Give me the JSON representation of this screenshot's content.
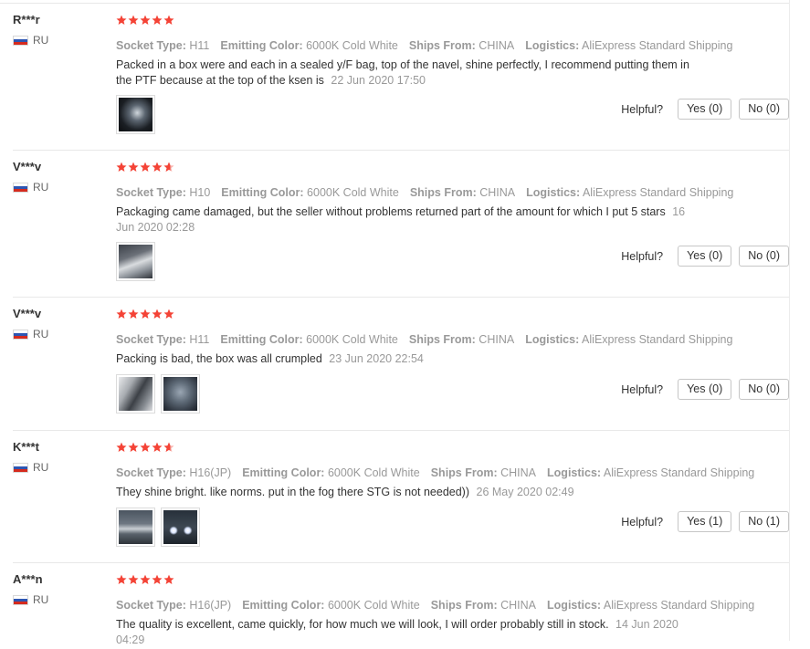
{
  "labels": {
    "socket_type": "Socket Type:",
    "emitting_color": "Emitting Color:",
    "ships_from": "Ships From:",
    "logistics": "Logistics:",
    "helpful": "Helpful?"
  },
  "colors": {
    "star": "#f44336",
    "muted": "#999999",
    "text": "#333333"
  },
  "reviews": [
    {
      "user": "R***r",
      "country": "RU",
      "rating": 5,
      "socket_type": "H11",
      "emitting_color": "6000K Cold White",
      "ships_from": "CHINA",
      "logistics": "AliExpress Standard Shipping",
      "text": "Packed in a box were and each in a sealed y/F bag, top of the navel, shine perfectly, I recommend putting them in the PTF because at the top of the ksen is",
      "date": "22 Jun 2020 17:50",
      "photos": [
        "dark-road-photo"
      ],
      "yes": "Yes (0)",
      "no": "No (0)"
    },
    {
      "user": "V***v",
      "country": "RU",
      "rating": 4.5,
      "socket_type": "H10",
      "emitting_color": "6000K Cold White",
      "ships_from": "CHINA",
      "logistics": "AliExpress Standard Shipping",
      "text": "Packaging came damaged, but the seller without problems returned part of the amount for which I put 5 stars",
      "date": "16 Jun 2020 02:28",
      "photos": [
        "hand-package-photo"
      ],
      "yes": "Yes (0)",
      "no": "No (0)"
    },
    {
      "user": "V***v",
      "country": "RU",
      "rating": 5,
      "socket_type": "H11",
      "emitting_color": "6000K Cold White",
      "ships_from": "CHINA",
      "logistics": "AliExpress Standard Shipping",
      "text": "Packing is bad, the box was all crumpled",
      "date": "23 Jun 2020 22:54",
      "photos": [
        "crumpled-box-photo",
        "box-closeup-photo"
      ],
      "yes": "Yes (0)",
      "no": "No (0)"
    },
    {
      "user": "K***t",
      "country": "RU",
      "rating": 4.5,
      "socket_type": "H16(JP)",
      "emitting_color": "6000K Cold White",
      "ships_from": "CHINA",
      "logistics": "AliExpress Standard Shipping",
      "text": "They shine bright. like norms. put in the fog there STG is not needed))",
      "date": "26 May 2020 02:49",
      "photos": [
        "car-side-photo",
        "car-front-lights-photo"
      ],
      "yes": "Yes (1)",
      "no": "No (1)"
    },
    {
      "user": "A***n",
      "country": "RU",
      "rating": 5,
      "socket_type": "H16(JP)",
      "emitting_color": "6000K Cold White",
      "ships_from": "CHINA",
      "logistics": "AliExpress Standard Shipping",
      "text": "The quality is excellent, came quickly, for how much we will look, I will order probably still in stock.",
      "date": "14 Jun 2020 04:29",
      "photos": [],
      "yes": "",
      "no": ""
    }
  ]
}
